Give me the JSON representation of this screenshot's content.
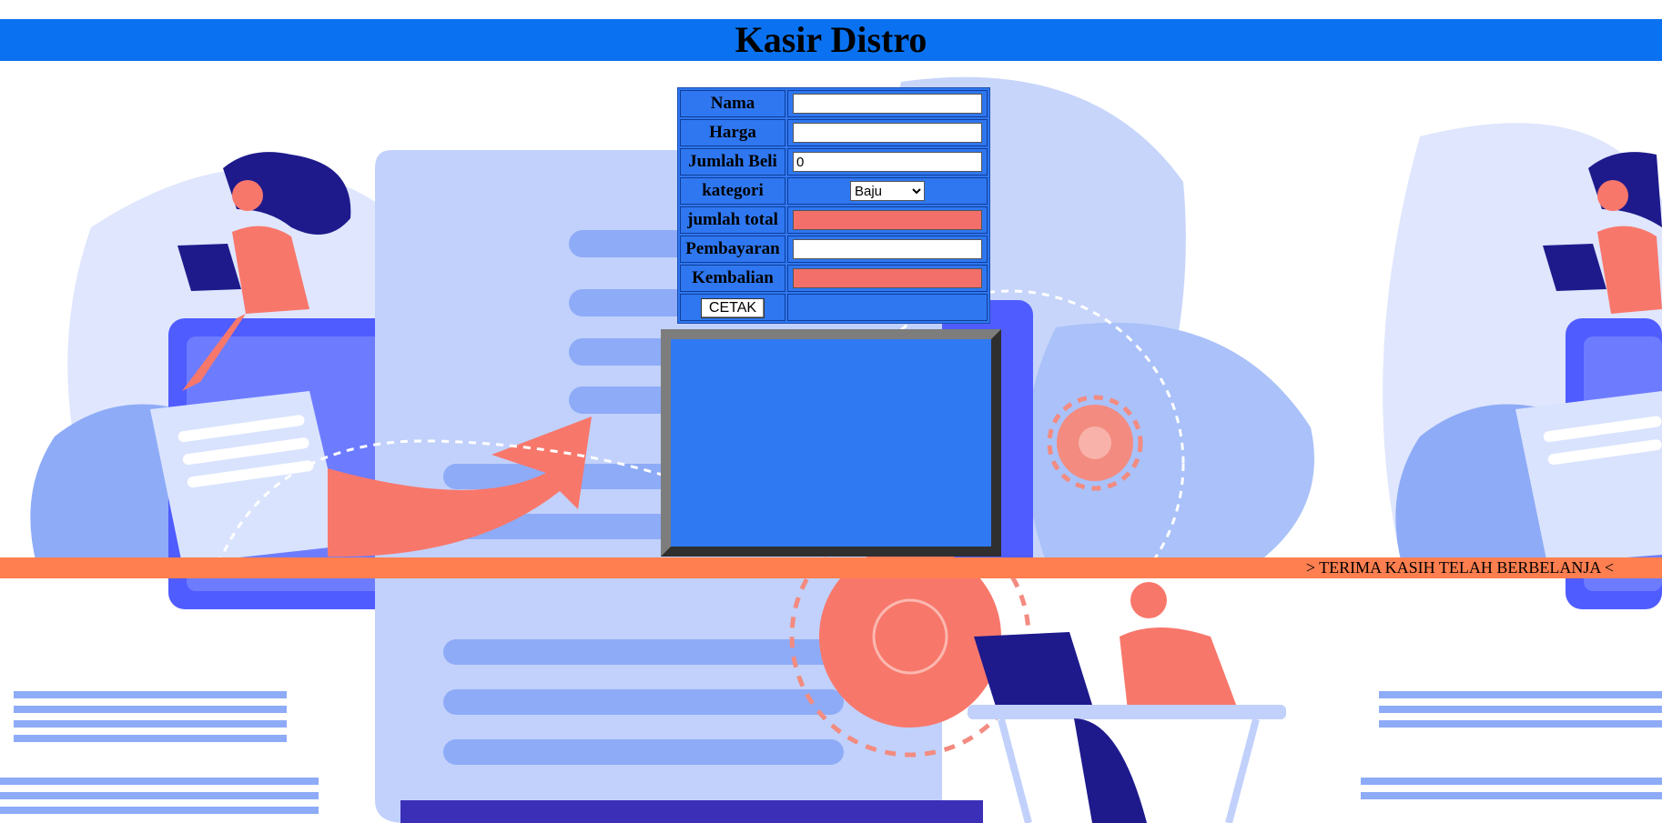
{
  "header": {
    "title": "Kasir Distro"
  },
  "form": {
    "nama": {
      "label": "Nama",
      "value": ""
    },
    "harga": {
      "label": "Harga",
      "value": ""
    },
    "jumlah_beli": {
      "label": "Jumlah Beli",
      "value": "0"
    },
    "kategori": {
      "label": "kategori",
      "selected": "Baju"
    },
    "jumlah_total": {
      "label": "jumlah total",
      "value": ""
    },
    "pembayaran": {
      "label": "Pembayaran",
      "value": ""
    },
    "kembalian": {
      "label": "Kembalian",
      "value": ""
    },
    "cetak_label": "CETAK"
  },
  "output": {
    "text": ""
  },
  "marquee": {
    "text": "> TERIMA KASIH TELAH BERBELANJA <"
  },
  "colors": {
    "header": "#0a72f0",
    "form_bg": "#2f77f0",
    "readonly_field": "#f3706a",
    "marquee_bar": "#ff7f50",
    "illustration_accent": "#4f5cff"
  },
  "background": {
    "icons": [
      "person-with-laptop-icon",
      "document-icon",
      "arrow-icon",
      "gear-icon",
      "leaf-icon"
    ]
  }
}
